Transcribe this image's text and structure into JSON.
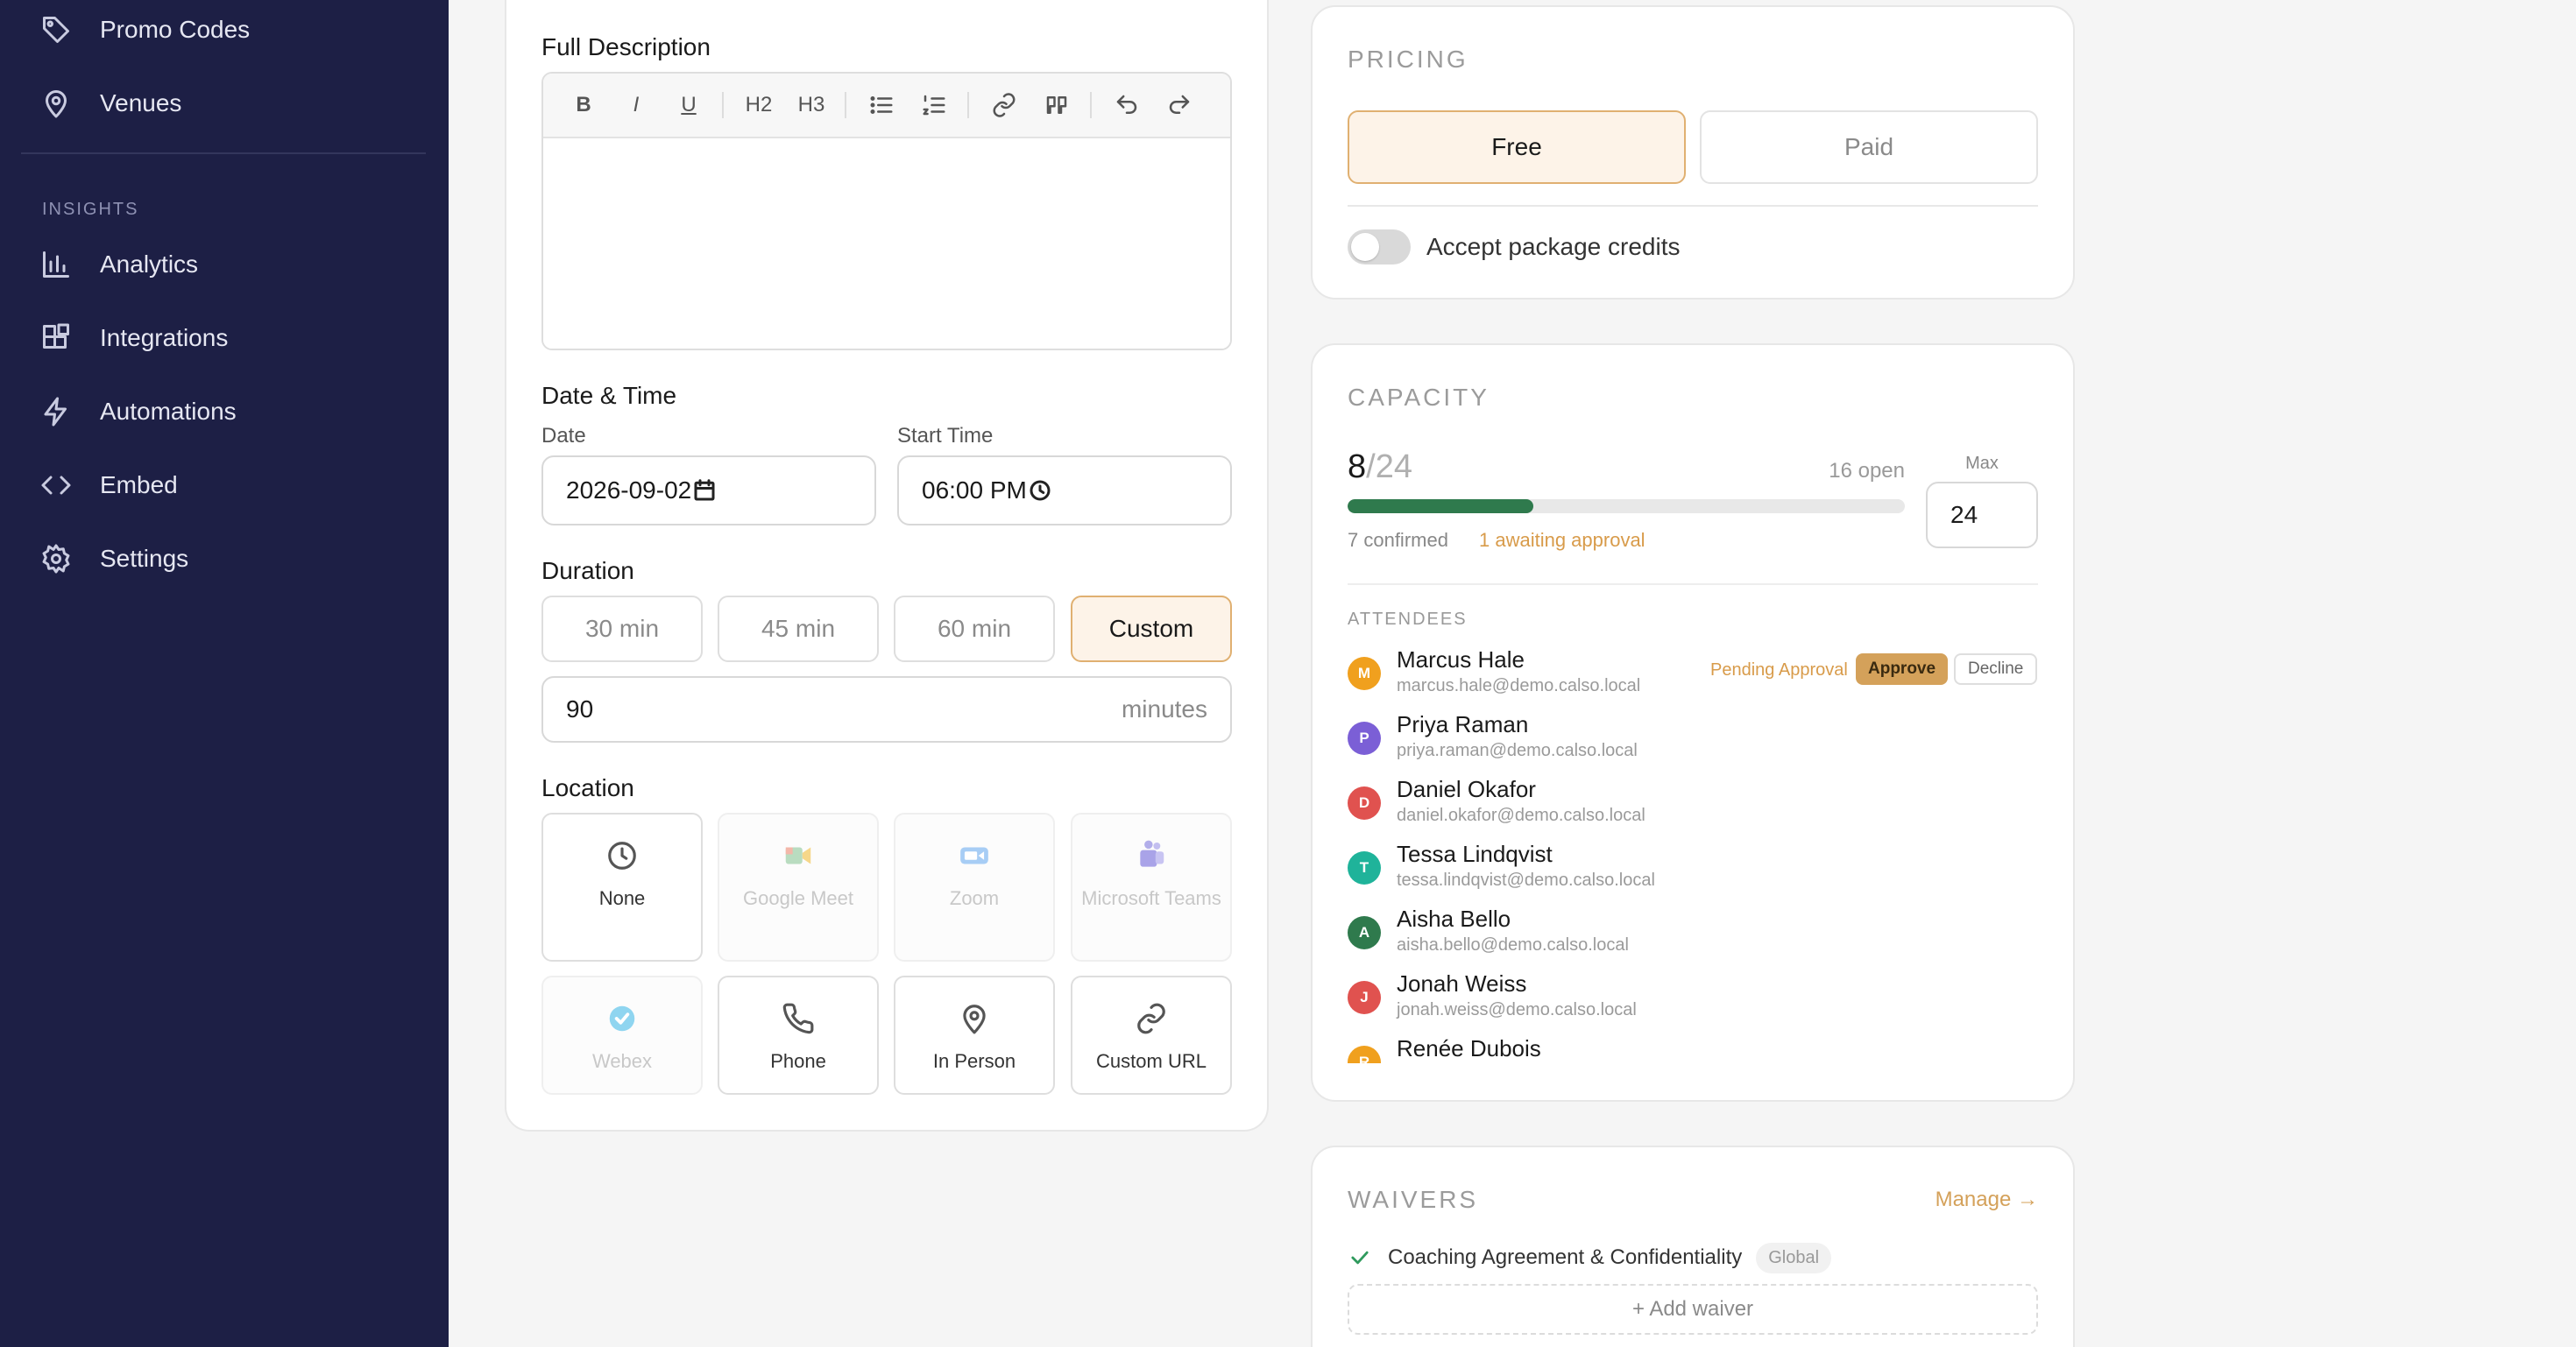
{
  "sidebar": {
    "items_top": [
      {
        "label": "Promo Codes",
        "icon": "tag-icon"
      },
      {
        "label": "Venues",
        "icon": "map-pin-icon"
      }
    ],
    "section_insights": "INSIGHTS",
    "items_insights": [
      {
        "label": "Analytics",
        "icon": "bar-chart-icon"
      },
      {
        "label": "Integrations",
        "icon": "blocks-icon"
      },
      {
        "label": "Automations",
        "icon": "zap-icon"
      },
      {
        "label": "Embed",
        "icon": "code-icon"
      },
      {
        "label": "Settings",
        "icon": "gear-icon"
      }
    ]
  },
  "form": {
    "full_description_label": "Full Description",
    "editor_toolbar": {
      "bold": "B",
      "italic": "I",
      "underline": "U",
      "h2": "H2",
      "h3": "H3"
    },
    "date_time_label": "Date & Time",
    "date_label": "Date",
    "date_value": "2026-09-02",
    "start_time_label": "Start Time",
    "start_time_value": "06:00 PM",
    "duration_label": "Duration",
    "duration_options": [
      "30 min",
      "45 min",
      "60 min",
      "Custom"
    ],
    "duration_selected": "Custom",
    "custom_duration_value": "90",
    "custom_duration_unit": "minutes",
    "location_label": "Location",
    "location_options": [
      {
        "label": "None",
        "icon": "clock-icon",
        "enabled": true
      },
      {
        "label": "Google Meet",
        "icon": "google-meet-icon",
        "enabled": false
      },
      {
        "label": "Zoom",
        "icon": "zoom-icon",
        "enabled": false
      },
      {
        "label": "Microsoft Teams",
        "icon": "teams-icon",
        "enabled": false
      },
      {
        "label": "Webex",
        "icon": "webex-icon",
        "enabled": false
      },
      {
        "label": "Phone",
        "icon": "phone-icon",
        "enabled": true
      },
      {
        "label": "In Person",
        "icon": "map-pin-icon",
        "enabled": true
      },
      {
        "label": "Custom URL",
        "icon": "link-icon",
        "enabled": true
      }
    ]
  },
  "pricing": {
    "title": "PRICING",
    "free_label": "Free",
    "paid_label": "Paid",
    "selected": "Free",
    "accept_credits_label": "Accept package credits",
    "accept_credits_enabled": false
  },
  "capacity": {
    "title": "CAPACITY",
    "booked": "8",
    "total": "/24",
    "open_text": "16 open",
    "max_label": "Max",
    "max_value": "24",
    "fill_fraction": 0.333,
    "confirmed_text": "7 confirmed",
    "awaiting_text": "1 awaiting approval",
    "attendees_label": "ATTENDEES",
    "pending_label": "Pending Approval",
    "approve_label": "Approve",
    "decline_label": "Decline",
    "attendees": [
      {
        "initial": "M",
        "name": "Marcus Hale",
        "email": "marcus.hale@demo.calso.local",
        "color": "#f0a01e",
        "pending": true
      },
      {
        "initial": "P",
        "name": "Priya Raman",
        "email": "priya.raman@demo.calso.local",
        "color": "#7b5fd6",
        "pending": false
      },
      {
        "initial": "D",
        "name": "Daniel Okafor",
        "email": "daniel.okafor@demo.calso.local",
        "color": "#e0524f",
        "pending": false
      },
      {
        "initial": "T",
        "name": "Tessa Lindqvist",
        "email": "tessa.lindqvist@demo.calso.local",
        "color": "#1fb39a",
        "pending": false
      },
      {
        "initial": "A",
        "name": "Aisha Bello",
        "email": "aisha.bello@demo.calso.local",
        "color": "#2f7a4d",
        "pending": false
      },
      {
        "initial": "J",
        "name": "Jonah Weiss",
        "email": "jonah.weiss@demo.calso.local",
        "color": "#e0524f",
        "pending": false
      },
      {
        "initial": "R",
        "name": "Renée Dubois",
        "email": "",
        "color": "#f0a01e",
        "pending": false
      }
    ]
  },
  "waivers": {
    "title": "WAIVERS",
    "manage_label": "Manage →",
    "items": [
      {
        "name": "Coaching Agreement & Confidentiality",
        "tag": "Global"
      }
    ],
    "add_label": "+ Add waiver"
  },
  "colors": {
    "sidebar_bg": "#1d1f45",
    "accent": "#d4a15a",
    "accent_light": "#fdf3e8",
    "success": "#2f7a4d"
  }
}
